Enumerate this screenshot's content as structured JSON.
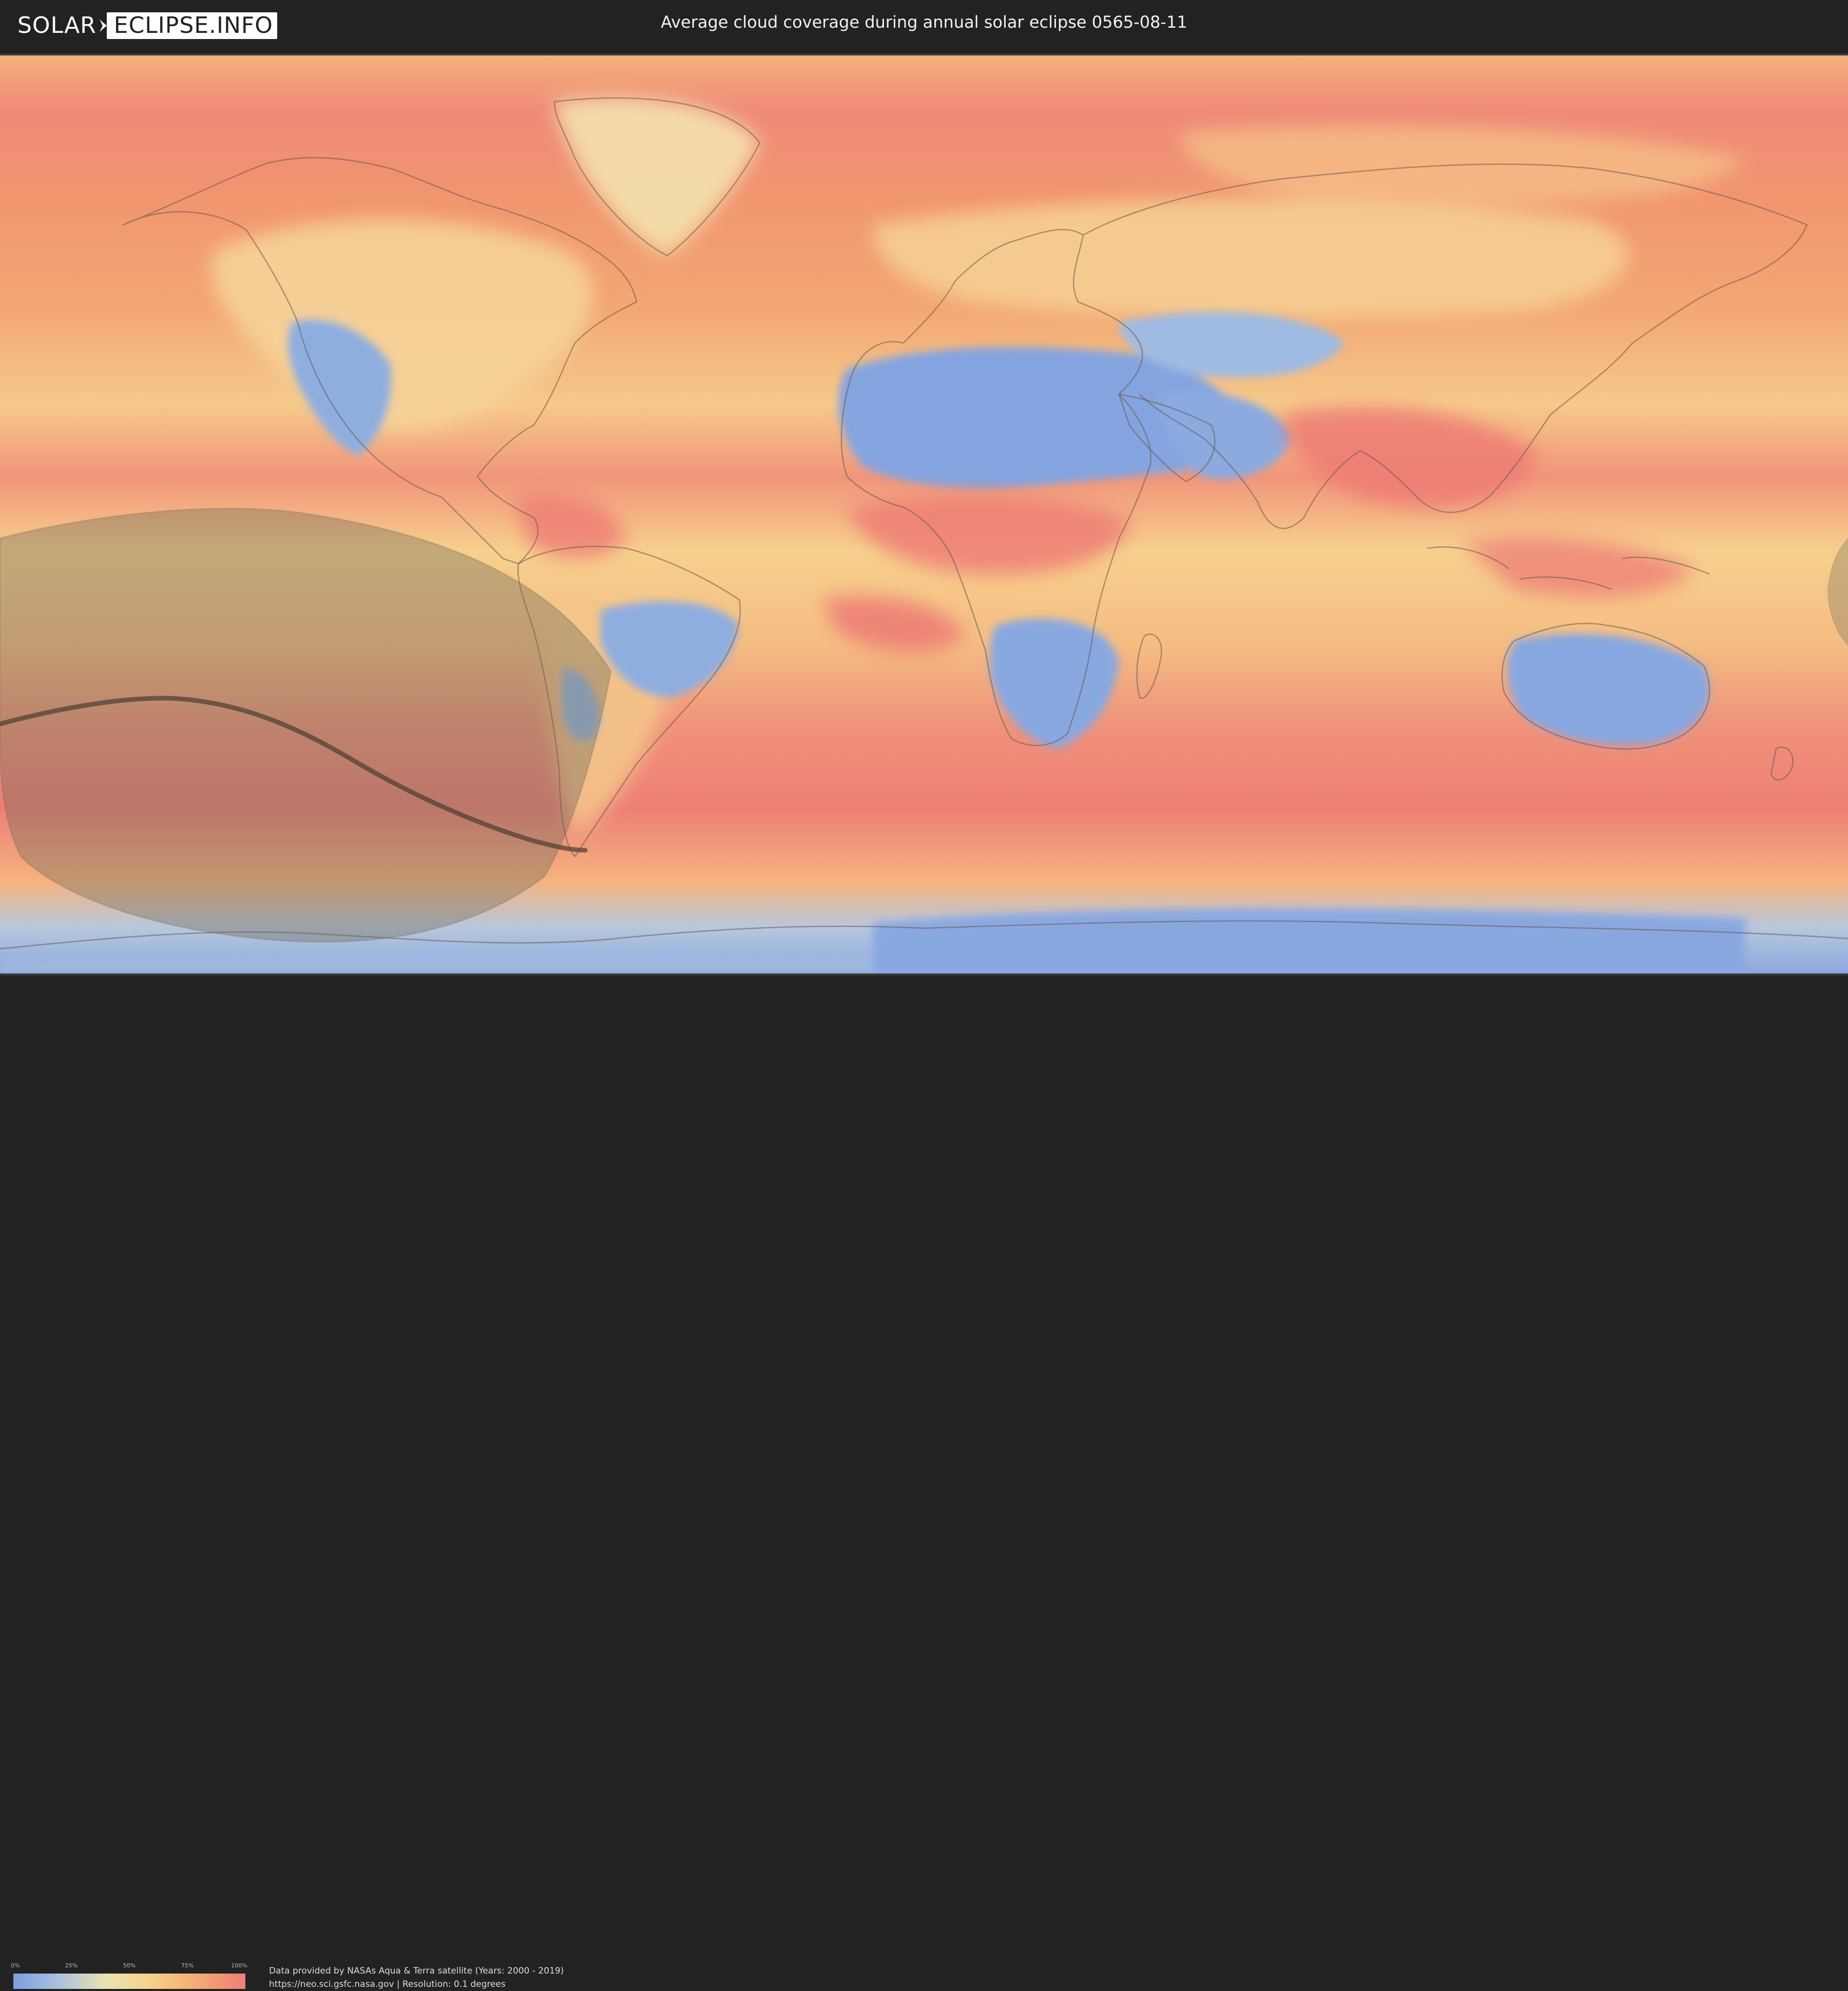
{
  "header": {
    "logo": {
      "part1": "SOLAR",
      "part2": "ECLIPSE.INFO"
    },
    "title": "Average cloud coverage during annual solar eclipse 0565-08-11"
  },
  "map": {
    "layer": "Average cloud coverage",
    "eclipse_type": "annular",
    "eclipse_date": "0565-08-11",
    "colors": {
      "clear": "#7c9fde",
      "low": "#a6bfe0",
      "mid": "#e9e3b2",
      "high": "#f4ae74",
      "overcast": "#ee7f76",
      "eclipse_shadow": "#6e6a58",
      "central_line": "#4a3d32",
      "coastline": "#6b5a52"
    }
  },
  "legend": {
    "ticks": [
      "0%",
      "25%",
      "50%",
      "75%",
      "100%"
    ],
    "gradient_colors": [
      "#7c9fde",
      "#a6bfe0",
      "#e9e3b2",
      "#f6d28a",
      "#f4ae74",
      "#ee7f76"
    ]
  },
  "footer": {
    "source_line": "Data provided by NASAs Aqua & Terra satellite (Years: 2000 - 2019)",
    "url_line": "https://neo.sci.gsfc.nasa.gov | Resolution: 0.1 degrees"
  }
}
